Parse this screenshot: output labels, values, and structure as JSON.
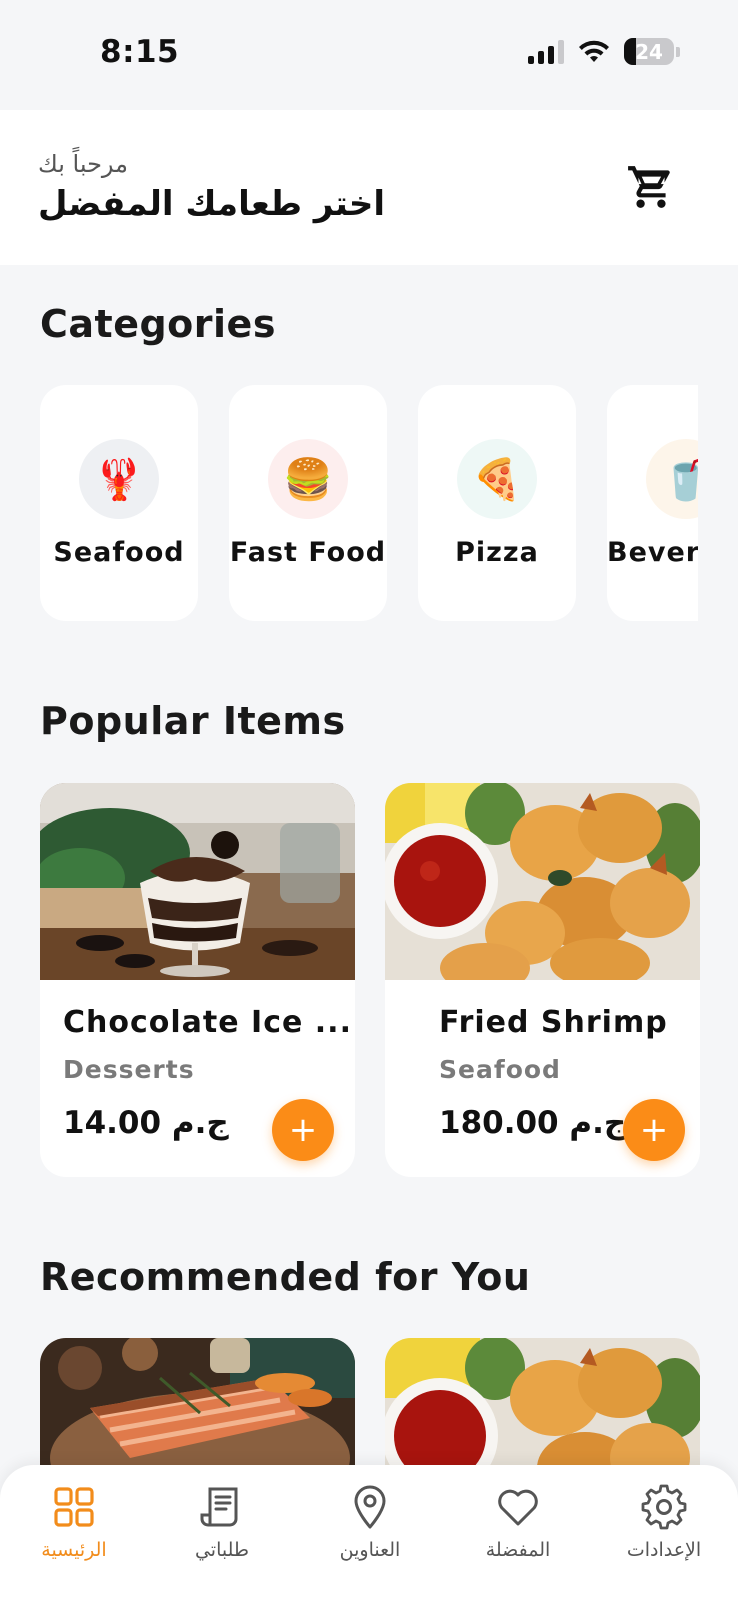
{
  "status_bar": {
    "time": "8:15",
    "battery": "24"
  },
  "header": {
    "greeting": "مرحباً بك",
    "headline": "اختر طعامك المفضل",
    "cart_icon": "cart-icon"
  },
  "categories": {
    "title": "Categories",
    "items": [
      {
        "label": "Seafood",
        "icon": "lobster-icon",
        "emoji": "🦞",
        "circle_color": "#eef0f3"
      },
      {
        "label": "Fast Food",
        "icon": "burger-icon",
        "emoji": "🍔",
        "circle_color": "#fdeeee"
      },
      {
        "label": "Pizza",
        "icon": "pizza-icon",
        "emoji": "🍕",
        "circle_color": "#eef8f6"
      },
      {
        "label": "Beverages",
        "icon": "drink-icon",
        "emoji": "🥤",
        "circle_color": "#fdf5ea"
      }
    ]
  },
  "popular": {
    "title": "Popular Items",
    "items": [
      {
        "name": "Chocolate Ice ...",
        "category": "Desserts",
        "price": "14.00 ج.م"
      },
      {
        "name": "Fried Shrimp",
        "category": "Seafood",
        "price": "180.00 ج.م"
      }
    ]
  },
  "recommended": {
    "title": "Recommended for You"
  },
  "nav": {
    "items": [
      {
        "label": "الرئيسية",
        "icon": "grid-icon",
        "active": true
      },
      {
        "label": "طلباتي",
        "icon": "receipt-icon",
        "active": false
      },
      {
        "label": "العناوين",
        "icon": "location-pin-icon",
        "active": false
      },
      {
        "label": "المفضلة",
        "icon": "heart-icon",
        "active": false
      },
      {
        "label": "الإعدادات",
        "icon": "gear-icon",
        "active": false
      }
    ]
  },
  "colors": {
    "accent": "#fb8c17",
    "active_nav": "#f28c1b",
    "background": "#f5f6f8"
  }
}
